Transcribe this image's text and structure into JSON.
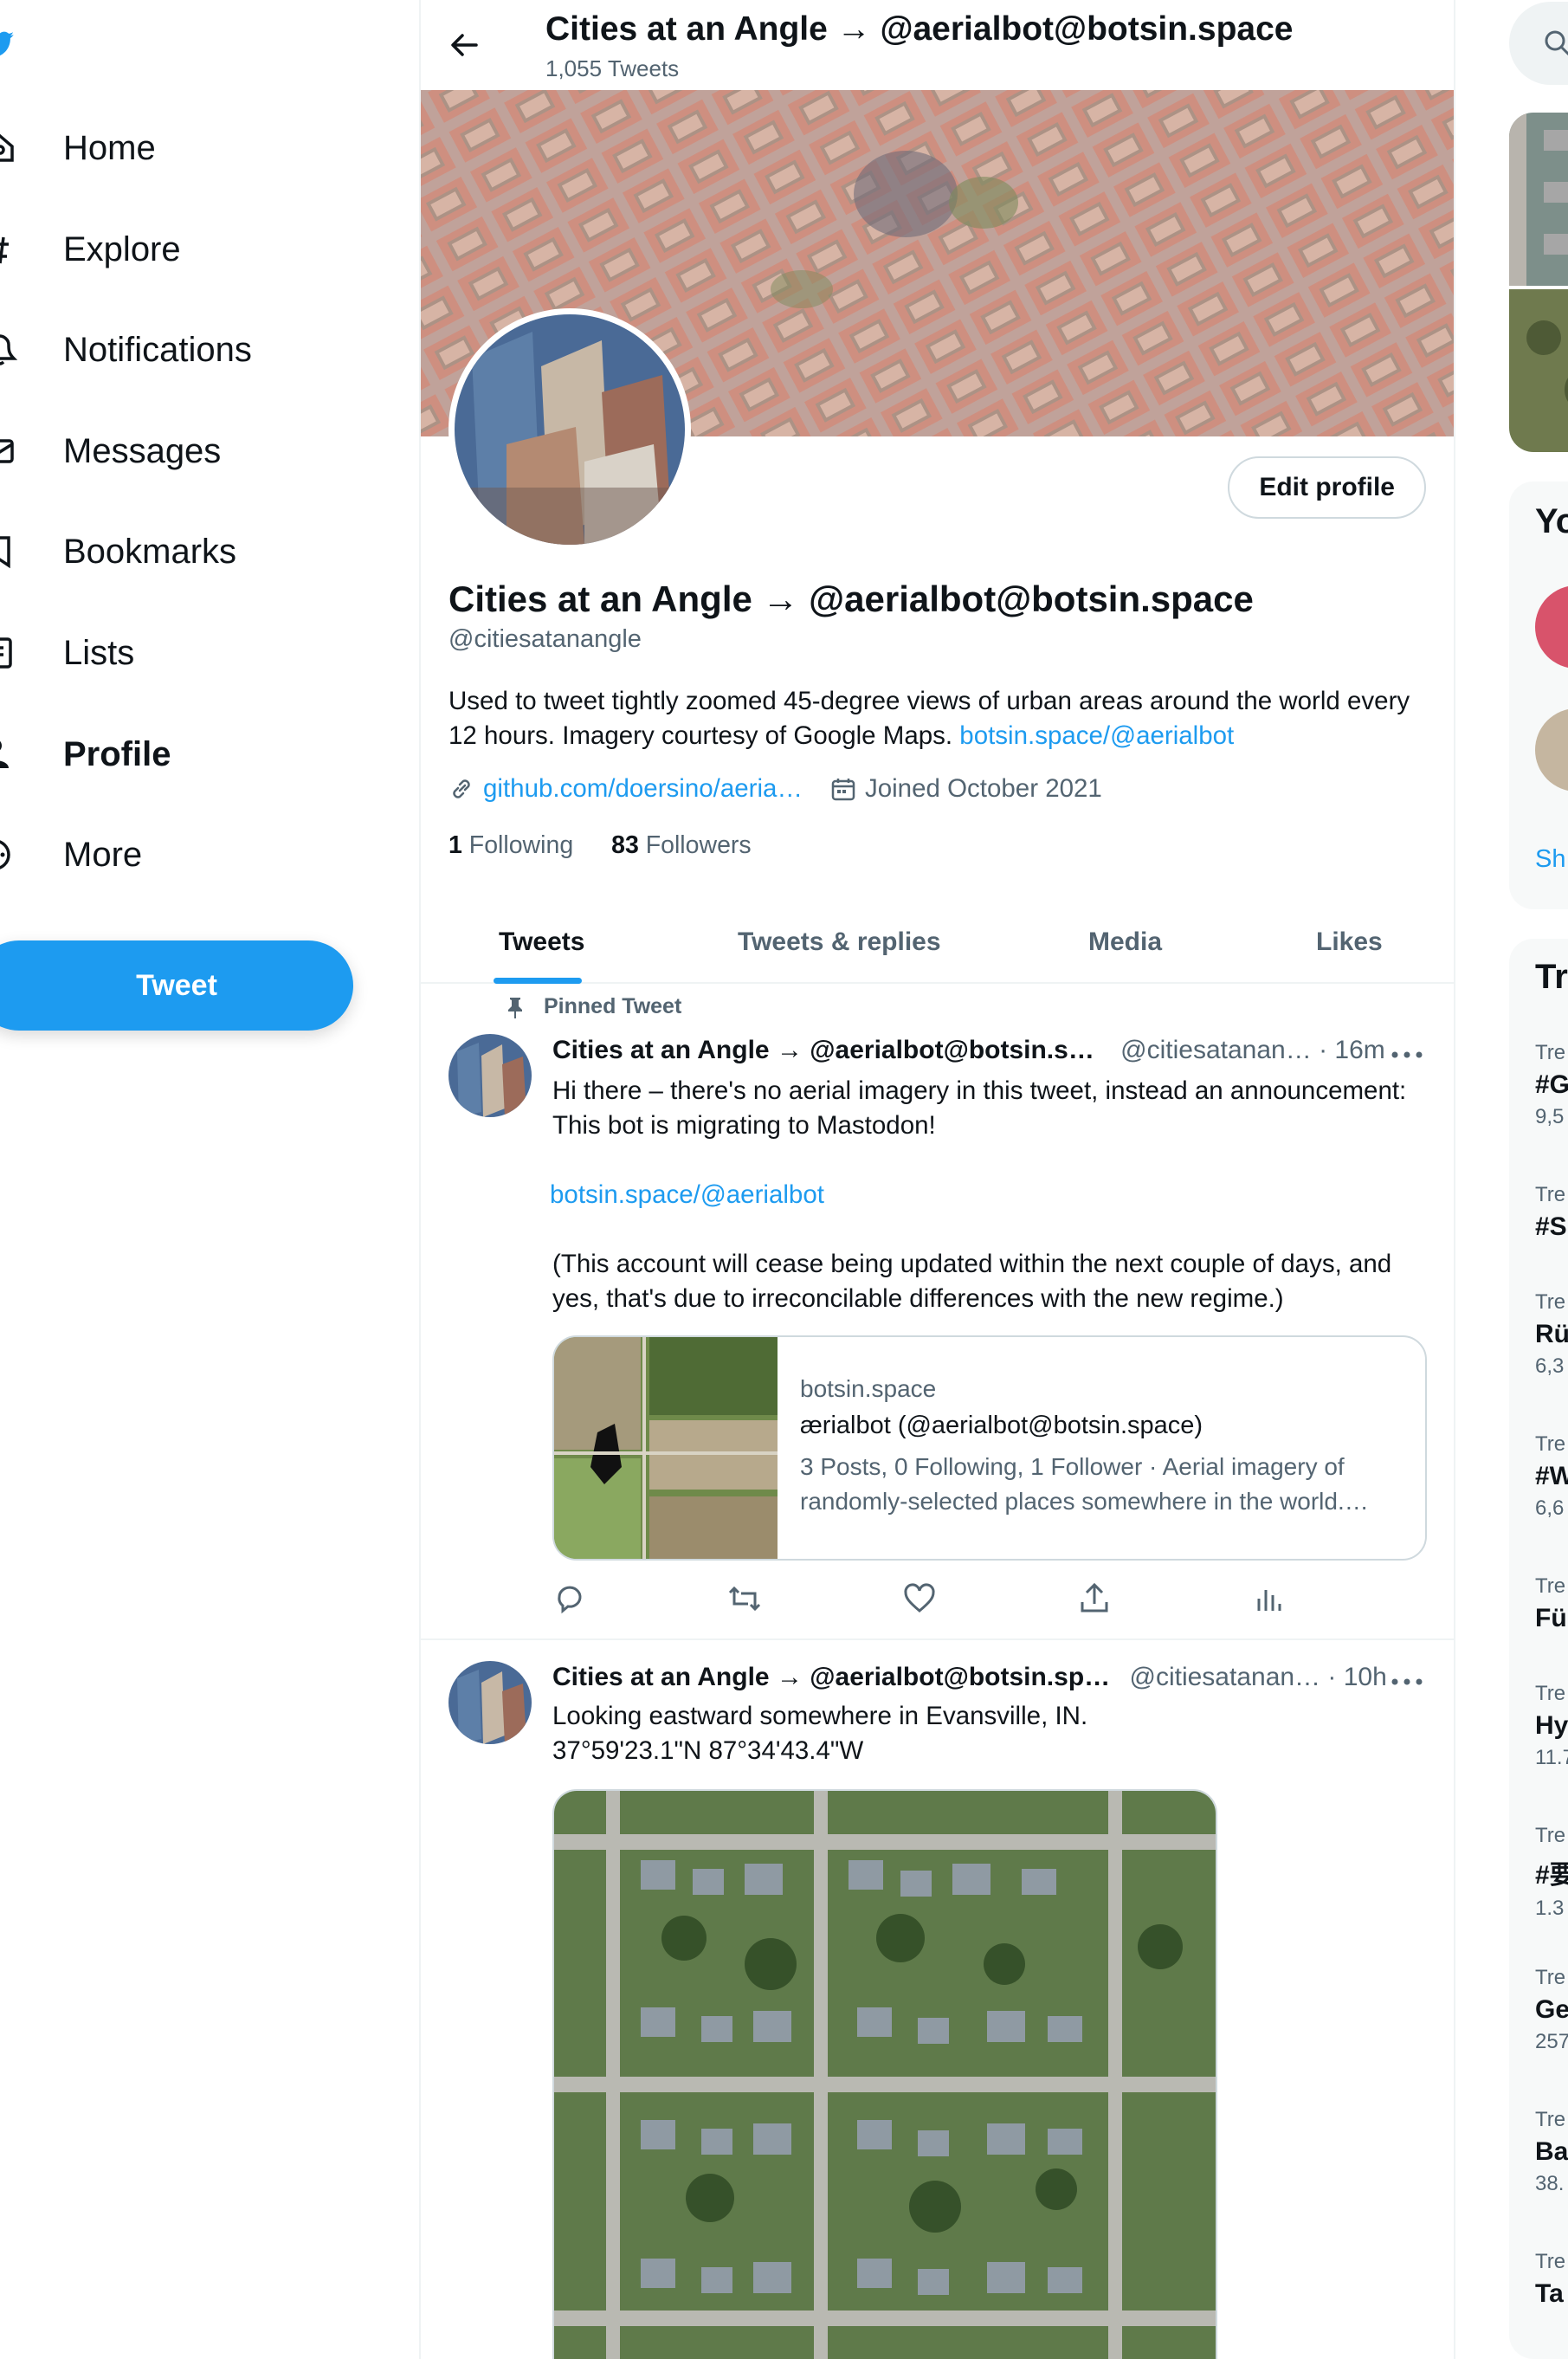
{
  "nav": {
    "items": [
      {
        "label": "Home",
        "icon": "home-icon"
      },
      {
        "label": "Explore",
        "icon": "hashtag-icon"
      },
      {
        "label": "Notifications",
        "icon": "bell-icon"
      },
      {
        "label": "Messages",
        "icon": "envelope-icon"
      },
      {
        "label": "Bookmarks",
        "icon": "bookmark-icon"
      },
      {
        "label": "Lists",
        "icon": "list-icon"
      },
      {
        "label": "Profile",
        "icon": "person-icon",
        "active": true
      },
      {
        "label": "More",
        "icon": "more-circle-icon"
      }
    ],
    "tweet_button": "Tweet"
  },
  "header": {
    "title": "Cities at an Angle → @aerialbot@botsin.space",
    "tweet_count": "1,055 Tweets"
  },
  "profile": {
    "name": "Cities at an Angle → @aerialbot@botsin.space",
    "handle": "@citiesatanangle",
    "bio_text": "Used to tweet tightly zoomed 45-degree views of urban areas around the world every 12 hours. Imagery courtesy of Google Maps.",
    "bio_link": "botsin.space/@aerialbot",
    "website": "github.com/doersino/aeria…",
    "joined": "Joined October 2021",
    "following_count": "1",
    "following_label": "Following",
    "followers_count": "83",
    "followers_label": "Followers",
    "edit_button": "Edit profile"
  },
  "tabs": [
    "Tweets",
    "Tweets & replies",
    "Media",
    "Likes"
  ],
  "tweets": [
    {
      "pinned_label": "Pinned Tweet",
      "name": "Cities at an Angle → @aerialbot@botsin.s…",
      "handle": "@citiesatanan…",
      "time": "· 16m",
      "text": "Hi there – there's no aerial imagery in this tweet, instead an announcement: This bot is migrating to Mastodon!",
      "link": "botsin.space/@aerialbot",
      "text2": "(This account will cease being updated within the next couple of days, and yes, that's due to irreconcilable differences with the new regime.)",
      "card": {
        "domain": "botsin.space",
        "title": "ærialbot (@aerialbot@botsin.space)",
        "description": "3 Posts, 0 Following, 1 Follower · Aerial imagery of randomly-selected places somewhere in the world.…"
      }
    },
    {
      "name": "Cities at an Angle → @aerialbot@botsin.sp…",
      "handle": "@citiesatanan…",
      "time": "· 10h",
      "text": "Looking eastward somewhere in Evansville, IN.\n37°59'23.1\"N 87°34'43.4\"W"
    }
  ],
  "right": {
    "who_to_follow_heading": "Yo",
    "show_more": "Sh",
    "trends_heading": "Tr",
    "trends": [
      {
        "label": "Tre",
        "name": "#G",
        "count": "9,5"
      },
      {
        "label": "Tre",
        "name": "#S",
        "count": ""
      },
      {
        "label": "Tre",
        "name": "Rü",
        "count": "6,3"
      },
      {
        "label": "Tre",
        "name": "#W",
        "count": "6,6"
      },
      {
        "label": "Tre",
        "name": "Fü",
        "count": ""
      },
      {
        "label": "Tre",
        "name": "Hy",
        "count": "11.7"
      },
      {
        "label": "Tre",
        "name": "#要",
        "count": "1.3"
      },
      {
        "label": "Tre",
        "name": "Ge",
        "count": "257"
      },
      {
        "label": "Tre",
        "name": "Ba",
        "count": "38."
      },
      {
        "label": "Tre",
        "name": "Ta",
        "count": ""
      }
    ]
  },
  "colors": {
    "accent": "#1d9bf0",
    "text": "#0f1419",
    "secondary_text": "#536471",
    "border": "#eff3f4"
  }
}
